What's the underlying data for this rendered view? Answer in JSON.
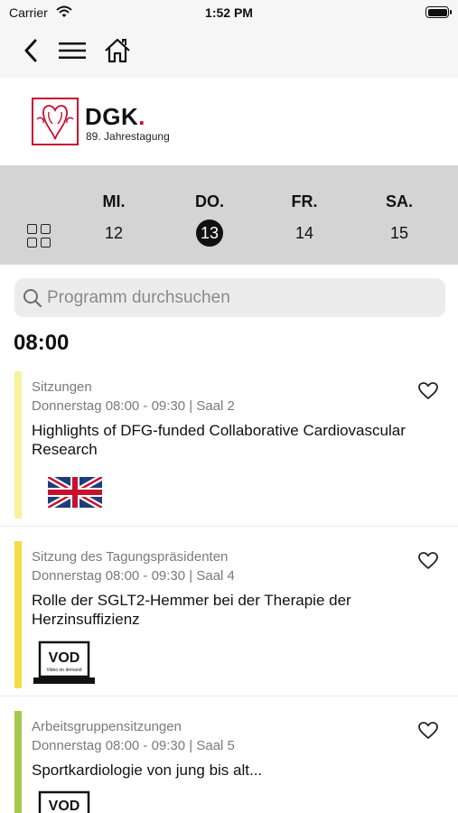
{
  "status_bar": {
    "carrier": "Carrier",
    "time": "1:52 PM"
  },
  "nav": {
    "icons": [
      "chevron-left-icon",
      "hamburger-menu-icon",
      "home-icon"
    ]
  },
  "logo": {
    "title": "DGK",
    "dot": ".",
    "subtitle": "89. Jahrestagung"
  },
  "days": [
    {
      "name": "MI.",
      "num": "12",
      "active": false
    },
    {
      "name": "DO.",
      "num": "13",
      "active": true
    },
    {
      "name": "FR.",
      "num": "14",
      "active": false
    },
    {
      "name": "SA.",
      "num": "15",
      "active": false
    }
  ],
  "search": {
    "placeholder": "Programm durchsuchen",
    "value": ""
  },
  "time_header": "08:00",
  "colors": {
    "accent": "#c8102e",
    "bar_yellow_light": "#f7f39c",
    "bar_yellow": "#f2dd48",
    "bar_green": "#a8c94f"
  },
  "sessions": [
    {
      "category": "Sitzungen",
      "meta": "Donnerstag 08:00 - 09:30 | Saal 2",
      "title": "Highlights of DFG-funded Collaborative Cardiovascular Research",
      "badge": "uk-flag-icon",
      "bar_color": "#f7f39c"
    },
    {
      "category": "Sitzung des Tagungspräsidenten",
      "meta": "Donnerstag 08:00 - 09:30 | Saal 4",
      "title": "Rolle der SGLT2-Hemmer bei der Therapie der Herzinsuffizienz",
      "badge": "vod-icon",
      "vod_label": "VOD",
      "vod_sub": "Video on demand",
      "bar_color": "#f2dd48"
    },
    {
      "category": "Arbeitsgruppensitzungen",
      "meta": "Donnerstag 08:00 - 09:30 | Saal 5",
      "title": "Sportkardiologie von jung bis alt...",
      "badge": "vod-icon",
      "vod_label": "VOD",
      "bar_color": "#a8c94f"
    }
  ]
}
